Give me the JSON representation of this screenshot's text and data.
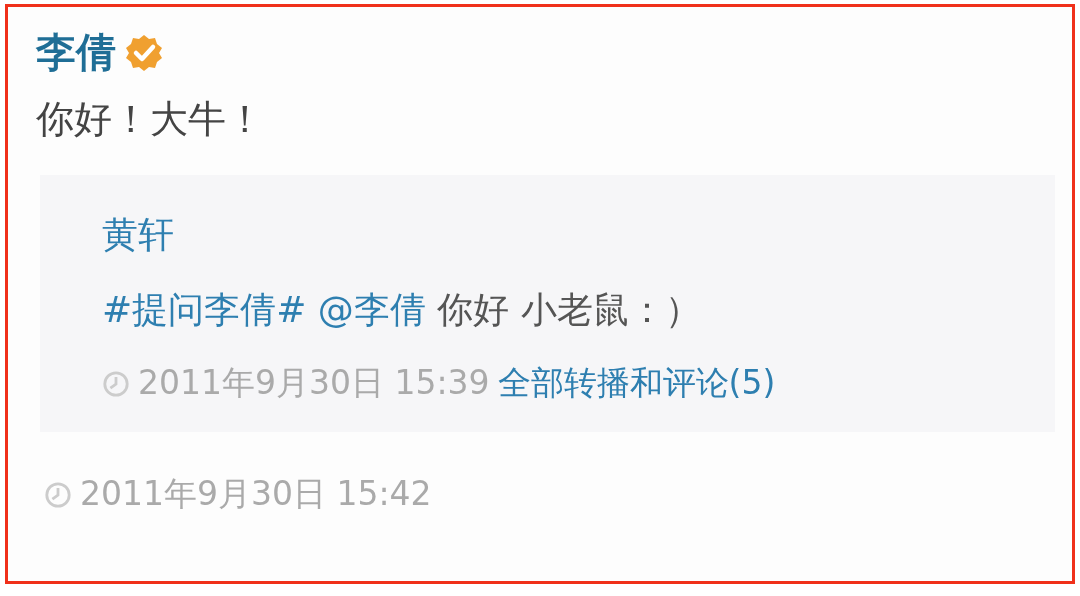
{
  "post": {
    "author": "李倩",
    "verified": true,
    "text": "你好！大牛！",
    "quote": {
      "author": "黄轩",
      "segments": [
        {
          "kind": "hashtag",
          "text": "#提问李倩#"
        },
        {
          "kind": "mention",
          "text": "@李倩"
        },
        {
          "kind": "plain",
          "text": "你好 小老鼠：）"
        }
      ],
      "time": "2011年9月30日 15:39",
      "link": "全部转播和评论(5)"
    },
    "time": "2011年9月30日 15:42"
  }
}
